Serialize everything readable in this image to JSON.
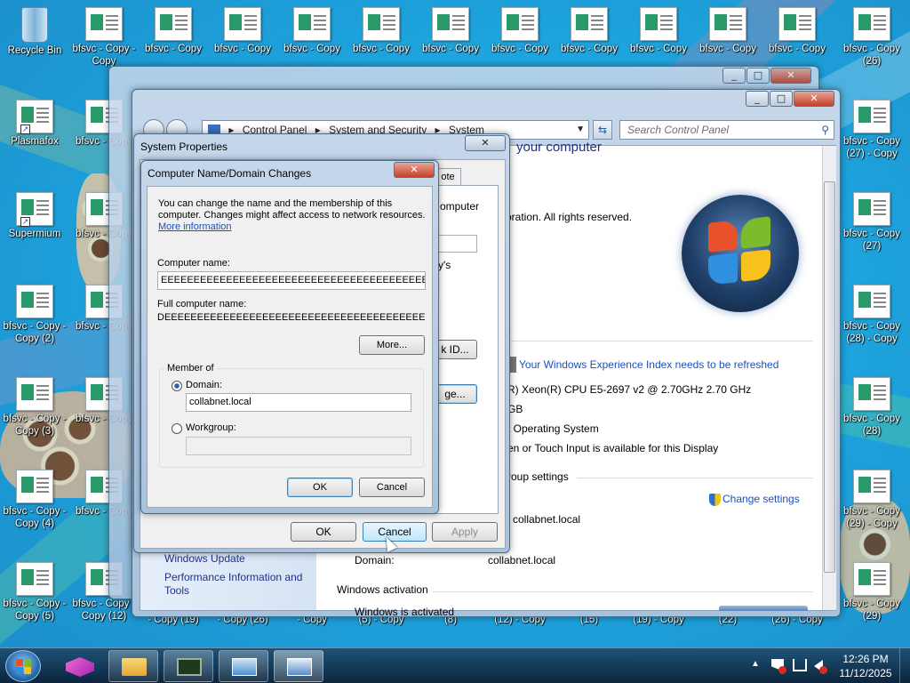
{
  "desktop": {
    "icons": [
      {
        "label": "Recycle Bin",
        "type": "bin",
        "col": 0,
        "row": 0
      },
      {
        "label": "bfsvc - Copy - Copy",
        "type": "file",
        "col": 1,
        "row": 0
      },
      {
        "label": "bfsvc - Copy",
        "type": "file",
        "col": 2,
        "row": 0
      },
      {
        "label": "bfsvc - Copy",
        "type": "file",
        "col": 3,
        "row": 0
      },
      {
        "label": "bfsvc - Copy",
        "type": "file",
        "col": 4,
        "row": 0
      },
      {
        "label": "bfsvc - Copy",
        "type": "file",
        "col": 5,
        "row": 0
      },
      {
        "label": "bfsvc - Copy",
        "type": "file",
        "col": 6,
        "row": 0
      },
      {
        "label": "bfsvc - Copy",
        "type": "file",
        "col": 7,
        "row": 0
      },
      {
        "label": "bfsvc - Copy",
        "type": "file",
        "col": 8,
        "row": 0
      },
      {
        "label": "bfsvc - Copy",
        "type": "file",
        "col": 9,
        "row": 0
      },
      {
        "label": "bfsvc - Copy",
        "type": "file",
        "col": 10,
        "row": 0
      },
      {
        "label": "bfsvc - Copy",
        "type": "file",
        "col": 11,
        "row": 0
      },
      {
        "label": "bfsvc - Copy (26)",
        "type": "file",
        "col": 12,
        "row": 0
      },
      {
        "label": "Plasmafox",
        "type": "shortcut",
        "col": 0,
        "row": 1
      },
      {
        "label": "bfsvc - Copy",
        "type": "file",
        "col": 1,
        "row": 1
      },
      {
        "label": "bfsvc - Copy (27) - Copy",
        "type": "file",
        "col": 12,
        "row": 1
      },
      {
        "label": "Supermium",
        "type": "shortcut",
        "col": 0,
        "row": 2
      },
      {
        "label": "bfsvc - Copy",
        "type": "file",
        "col": 1,
        "row": 2
      },
      {
        "label": "bfsvc - Copy (27)",
        "type": "file",
        "col": 12,
        "row": 2
      },
      {
        "label": "bfsvc - Copy - Copy (2)",
        "type": "file",
        "col": 0,
        "row": 3
      },
      {
        "label": "bfsvc - Copy",
        "type": "file",
        "col": 1,
        "row": 3
      },
      {
        "label": "bfsvc - Copy (28) - Copy",
        "type": "file",
        "col": 12,
        "row": 3
      },
      {
        "label": "bfsvc - Copy - Copy (3)",
        "type": "file",
        "col": 0,
        "row": 4
      },
      {
        "label": "bfsvc - Copy",
        "type": "file",
        "col": 1,
        "row": 4
      },
      {
        "label": "bfsvc - Copy (28)",
        "type": "file",
        "col": 12,
        "row": 4
      },
      {
        "label": "bfsvc - Copy - Copy (4)",
        "type": "file",
        "col": 0,
        "row": 5
      },
      {
        "label": "bfsvc - Copy",
        "type": "file",
        "col": 1,
        "row": 5
      },
      {
        "label": "bfsvc - Copy (29) - Copy",
        "type": "file",
        "col": 12,
        "row": 5
      },
      {
        "label": "bfsvc - Copy - Copy (5)",
        "type": "file",
        "col": 0,
        "row": 6
      },
      {
        "label": "bfsvc - Copy - Copy (12)",
        "type": "file",
        "col": 1,
        "row": 6
      },
      {
        "label": "- Copy (19)",
        "type": "label",
        "col": 2,
        "row": 6
      },
      {
        "label": "- Copy (26)",
        "type": "label",
        "col": 3,
        "row": 6
      },
      {
        "label": "- Copy",
        "type": "label",
        "col": 4,
        "row": 6
      },
      {
        "label": "(5) - Copy",
        "type": "label",
        "col": 5,
        "row": 6
      },
      {
        "label": "(8)",
        "type": "label",
        "col": 6,
        "row": 6
      },
      {
        "label": "(12) - Copy",
        "type": "label",
        "col": 7,
        "row": 6
      },
      {
        "label": "(15)",
        "type": "label",
        "col": 8,
        "row": 6
      },
      {
        "label": "(19) - Copy",
        "type": "label",
        "col": 9,
        "row": 6
      },
      {
        "label": "(22)",
        "type": "label",
        "col": 10,
        "row": 6
      },
      {
        "label": "(26) - Copy",
        "type": "label",
        "col": 11,
        "row": 6
      },
      {
        "label": "bfsvc - Copy (29)",
        "type": "file",
        "col": 12,
        "row": 6
      }
    ]
  },
  "control_panel": {
    "breadcrumb": [
      "Control Panel",
      "System and Security",
      "System"
    ],
    "search_placeholder": "Search Control Panel",
    "heading": "your computer",
    "copyright": "oration.  All rights reserved.",
    "wei_link": "Your Windows Experience Index needs to be refreshed",
    "processor": "R) Xeon(R) CPU E5-2697 v2 @ 2.70GHz   2.70 GHz",
    "memory": "GB",
    "system_type": "t Operating System",
    "pen_touch": "en or Touch Input is available for this Display",
    "group_label": "roup settings",
    "change_settings": "Change settings",
    "domain_value_top": "collabnet.local",
    "domain_label": "Domain:",
    "domain_value": "collabnet.local",
    "activation_heading": "Windows activation",
    "activation_status": "Windows is activated",
    "sidebar_update": "Windows Update",
    "sidebar_perf": "Performance Information and Tools"
  },
  "system_properties": {
    "title": "System Properties",
    "tab_remote": "ote",
    "frag_computer": "omputer",
    "frag_ys": "y's",
    "frag_id": "k ID...",
    "frag_change": "ge...",
    "ok": "OK",
    "cancel": "Cancel",
    "apply": "Apply"
  },
  "dialog": {
    "title": "Computer Name/Domain Changes",
    "intro_1": "You can change the name and the membership of this",
    "intro_2": "computer. Changes might affect access to network resources.",
    "more_info": "More information",
    "computer_name_label": "Computer name:",
    "computer_name_value": "EEEEEEEEEEEEEEEEEEEEEEEEEEEEEEEEEEEEEEEEE",
    "full_name_label": "Full computer name:",
    "full_name_value": "DEEEEEEEEEEEEEEEEEEEEEEEEEEEEEEEEEEEEEEEEE",
    "more_button": "More...",
    "member_of": "Member of",
    "domain_radio": "Domain:",
    "domain_value": "collabnet.local",
    "workgroup_radio": "Workgroup:",
    "workgroup_value": "",
    "ok": "OK",
    "cancel": "Cancel"
  },
  "taskbar": {
    "time": "12:26 PM",
    "date": "11/12/2025"
  }
}
